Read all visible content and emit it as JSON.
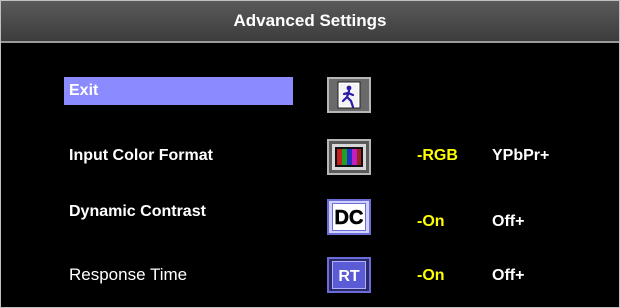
{
  "title": "Advanced Settings",
  "menu": {
    "exit_label": "Exit",
    "rows": [
      {
        "label": "Input Color Format",
        "icon": "color-bars-icon",
        "left_option": "-RGB",
        "right_option": "YPbPr+"
      },
      {
        "label": "Dynamic Contrast",
        "icon": "dc-icon",
        "icon_text": "DC",
        "left_option": "-On",
        "right_option": "Off+"
      },
      {
        "label": "Response Time",
        "icon": "rt-icon",
        "icon_text": "RT",
        "left_option": "-On",
        "right_option": "Off+"
      }
    ]
  },
  "colors": {
    "title_bar": "#4a4a4a",
    "highlight": "#8b8bff",
    "option_selected": "#ffff00",
    "option_other": "#ffffff",
    "background": "#000000"
  },
  "icons": {
    "exit": "exit-door-icon"
  }
}
